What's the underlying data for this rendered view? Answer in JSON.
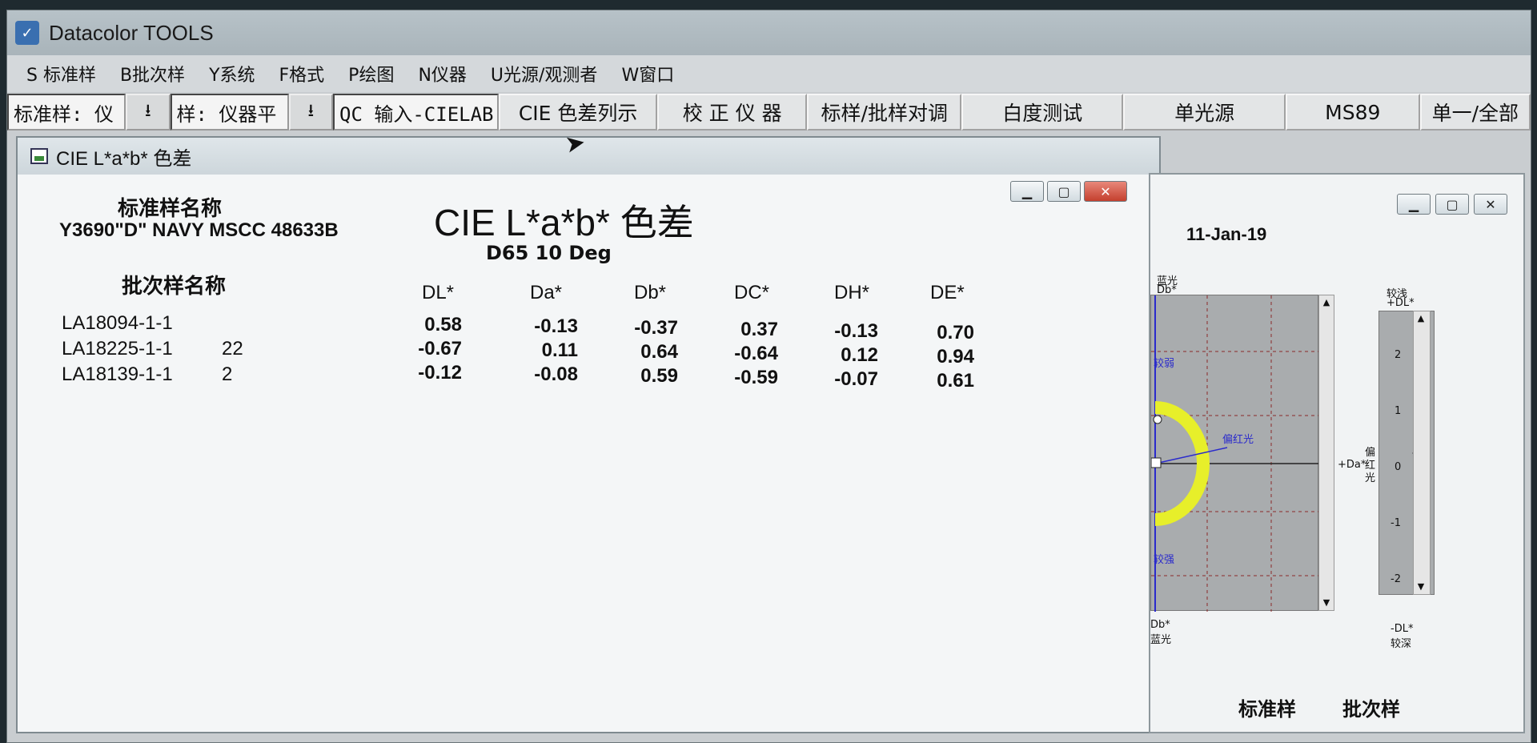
{
  "app": {
    "title": "Datacolor TOOLS"
  },
  "menu": [
    {
      "label": "S 标准样"
    },
    {
      "label": "B批次样"
    },
    {
      "label": "Y系统"
    },
    {
      "label": "F格式"
    },
    {
      "label": "P绘图"
    },
    {
      "label": "N仪器"
    },
    {
      "label": "U光源/观测者"
    },
    {
      "label": "W窗口"
    }
  ],
  "toolbar": {
    "std_field": "标准样: 仪",
    "batch_field": "样: 仪器平",
    "qc_field": "QC 输入-CIELAB",
    "buttons": [
      "CIE 色差列示",
      "校 正 仪 器",
      "标样/批样对调",
      "白度测试",
      "单光源",
      "MS89",
      "单一/全部"
    ]
  },
  "child_window": {
    "title": "CIE L*a*b* 色差",
    "std_header": "标准样名称",
    "std_name": "Y3690\"D\" NAVY MSCC 48633B",
    "main_title": "CIE L*a*b* 色差",
    "illuminant": "D65 10 Deg",
    "batch_header": "批次样名称",
    "columns": [
      "DL*",
      "Da*",
      "Db*",
      "DC*",
      "DH*",
      "DE*"
    ],
    "rows": [
      {
        "name": "LA18094-1-1",
        "extra": "",
        "values": [
          "0.58",
          "-0.13",
          "-0.37",
          "0.37",
          "-0.13",
          "0.70"
        ]
      },
      {
        "name": "LA18225-1-1",
        "extra": "22",
        "values": [
          "-0.67",
          "0.11",
          "0.64",
          "-0.64",
          "0.12",
          "0.94"
        ]
      },
      {
        "name": "LA18139-1-1",
        "extra": "2",
        "values": [
          "-0.12",
          "-0.08",
          "0.59",
          "-0.59",
          "-0.07",
          "0.61"
        ]
      }
    ]
  },
  "side_window": {
    "date": "11-Jan-19",
    "plot_labels": {
      "top": "蓝光",
      "top_axis": "Db*",
      "upper_region": "较弱",
      "red_label": "偏红光",
      "da_axis": "+Da*",
      "lower_region": "较强",
      "bottom_axis": "Db*",
      "bottom": "蓝光",
      "v_top": "较浅",
      "v_top_axis": "+DL*",
      "v_side": "偏红光",
      "v_bottom_axis": "-DL*",
      "v_bottom": "较深",
      "ticks": [
        "2",
        "1",
        "0",
        "-1",
        "-2"
      ]
    },
    "footer_std": "标准样",
    "footer_batch": "批次样"
  },
  "icons": {
    "minimize": "minimize-icon",
    "maximize": "maximize-icon",
    "close": "close-icon",
    "download": "download-arrow-icon"
  }
}
